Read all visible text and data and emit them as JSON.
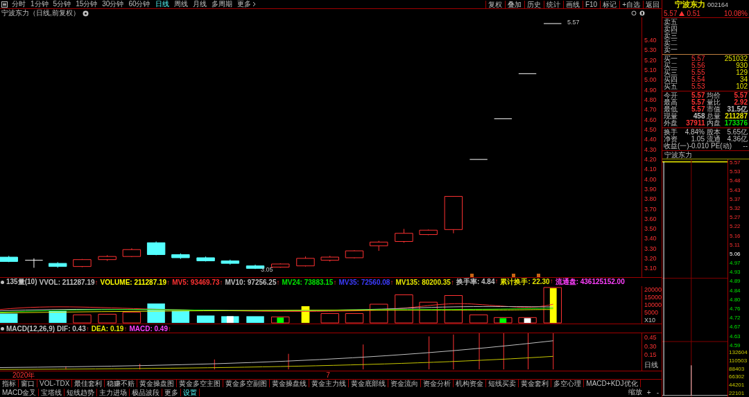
{
  "periods": [
    {
      "label": "分时",
      "selected": false
    },
    {
      "label": "1分钟",
      "selected": false
    },
    {
      "label": "5分钟",
      "selected": false
    },
    {
      "label": "15分钟",
      "selected": false
    },
    {
      "label": "30分钟",
      "selected": false
    },
    {
      "label": "60分钟",
      "selected": false
    },
    {
      "label": "日线",
      "selected": true
    },
    {
      "label": "周线",
      "selected": false
    },
    {
      "label": "月线",
      "selected": false
    },
    {
      "label": "多周期",
      "selected": false
    }
  ],
  "more": "更多",
  "tools": [
    "复权",
    "叠加",
    "历史",
    "统计",
    "画线",
    "F10",
    "标记",
    "+自选",
    "返回"
  ],
  "chart_title": "宁波东力（日线,前复权）",
  "price_axis": [
    "5.40",
    "5.30",
    "5.20",
    "5.10",
    "5.00",
    "4.90",
    "4.80",
    "4.70",
    "4.60",
    "4.50",
    "4.40",
    "4.30",
    "4.20",
    "4.10",
    "4.00",
    "3.90",
    "3.80",
    "3.70",
    "3.60",
    "3.50",
    "3.40",
    "3.30",
    "3.20",
    "3.10"
  ],
  "high_label": "5.57",
  "low_label": "3.05",
  "volume_line": [
    {
      "text": "135量(10)",
      "color": "#c0c0c0"
    },
    {
      "text": "VVOL: 211287.19",
      "color": "#c0c0c0",
      "arrow": "↑"
    },
    {
      "text": "VOLUME: 211287.19",
      "color": "#ffff00",
      "arrow": "↑"
    },
    {
      "text": "MV5: 93469.73",
      "color": "#ff3232",
      "arrow": "↑"
    },
    {
      "text": "MV10: 97256.25",
      "color": "#c0c0c0",
      "arrow": "↑"
    },
    {
      "text": "MV24: 73883.15",
      "color": "#00e600",
      "arrow": "↑"
    },
    {
      "text": "MV35: 72560.08",
      "color": "#3c3cff",
      "arrow": "↑"
    },
    {
      "text": "MV135: 80200.35",
      "color": "#e6e600",
      "arrow": "↑"
    },
    {
      "text": "换手率: 4.84",
      "color": "#c0c0c0",
      "arrow": "↑"
    },
    {
      "text": "累计换手: 22.30",
      "color": "#e6e600",
      "arrow": "↑"
    },
    {
      "text": "流通盘: 436125152.00",
      "color": "#ff40ff"
    }
  ],
  "volume_axis": [
    "20000",
    "15000",
    "10000",
    "5000"
  ],
  "volume_unit": "X10",
  "macd_line": [
    {
      "text": "MACD(12,26,9)",
      "color": "#c0c0c0"
    },
    {
      "text": "DIF: 0.43",
      "color": "#c0c0c0",
      "arrow": "↑"
    },
    {
      "text": "DEA: 0.19",
      "color": "#e6e600",
      "arrow": "↑"
    },
    {
      "text": "MACD: 0.49",
      "color": "#ff40ff",
      "arrow": "↑"
    }
  ],
  "macd_axis": [
    "0.45",
    "0.30",
    "0.15"
  ],
  "macd_period": "日线",
  "year_label": "2020年",
  "month_label": "7",
  "bottom_tabs": [
    {
      "label": "指标",
      "selected": false
    },
    {
      "label": "窗口",
      "selected": false
    },
    {
      "label": "VOL-TDX",
      "selected": false
    },
    {
      "label": "最佳套利",
      "selected": false
    },
    {
      "label": "稳赚不赔",
      "selected": false
    },
    {
      "label": "黄金操盘图",
      "selected": false
    },
    {
      "label": "黄金多空主图",
      "selected": false
    },
    {
      "label": "黄金多空副图",
      "selected": false
    },
    {
      "label": "黄金操盘线",
      "selected": false
    },
    {
      "label": "黄金主力线",
      "selected": false
    },
    {
      "label": "黄金底部线",
      "selected": false
    },
    {
      "label": "资金流向",
      "selected": false
    },
    {
      "label": "资金分析",
      "selected": false
    },
    {
      "label": "机构资金",
      "selected": false
    },
    {
      "label": "短线买卖",
      "selected": false
    },
    {
      "label": "黄金套利",
      "selected": false
    },
    {
      "label": "多空心理",
      "selected": false
    },
    {
      "label": "MACD+KDJ优化",
      "selected": false
    },
    {
      "label": "MACD金叉",
      "selected": false
    },
    {
      "label": "宝塔线",
      "selected": false
    },
    {
      "label": "短线趋势",
      "selected": false
    },
    {
      "label": "主力进场",
      "selected": false
    },
    {
      "label": "极品波段",
      "selected": false
    },
    {
      "label": "更多",
      "selected": false
    },
    {
      "label": "设置",
      "selected": true
    }
  ],
  "zoom_label": "缩放",
  "zoom_in": "+",
  "zoom_out": "-",
  "quote": {
    "name": "宁波东力",
    "code": "002164",
    "price": "5.57",
    "change": "0.51",
    "percent": "10.08%"
  },
  "asks": [
    "卖五",
    "卖四",
    "卖三",
    "卖二",
    "卖一"
  ],
  "bids": [
    {
      "label": "买一",
      "price": "5.57",
      "volume": "251032"
    },
    {
      "label": "买二",
      "price": "5.56",
      "volume": "930"
    },
    {
      "label": "买三",
      "price": "5.55",
      "volume": "129"
    },
    {
      "label": "买四",
      "price": "5.54",
      "volume": "34"
    },
    {
      "label": "买五",
      "price": "5.53",
      "volume": "102"
    }
  ],
  "stats": [
    {
      "label": "今开",
      "value": "5.57",
      "color": "#ff3232"
    },
    {
      "label": "均价",
      "value": "5.57",
      "color": "#ff3232"
    },
    {
      "label": "最高",
      "value": "5.57",
      "color": "#ff3232"
    },
    {
      "label": "量比",
      "value": "2.92",
      "color": "#ff3232"
    },
    {
      "label": "最低",
      "value": "5.57",
      "color": "#ff3232"
    },
    {
      "label": "市值",
      "value": "31.5亿",
      "color": "#c0c0c0"
    },
    {
      "label": "现量",
      "value": "458",
      "color": "#c0c0c0"
    },
    {
      "label": "总量",
      "value": "211287",
      "color": "#e6e600"
    },
    {
      "label": "外盘",
      "value": "37911",
      "color": "#ff3232"
    },
    {
      "label": "内盘",
      "value": "173376",
      "color": "#00e600"
    }
  ],
  "fundamentals": [
    {
      "label": "换手",
      "value": "4.84%",
      "label2": "股本",
      "value2": "5.65亿"
    },
    {
      "label": "净资",
      "value": "1.05",
      "label2": "流通",
      "value2": "4.36亿"
    },
    {
      "label": "收益(一)",
      "value": "-0.010",
      "label2": "PE(动)",
      "value2": "--"
    }
  ],
  "mini_title": "宁波东力",
  "mini_price_axis": [
    "5.57",
    "5.53",
    "5.48",
    "5.43",
    "5.37",
    "5.32",
    "5.27",
    "5.22",
    "5.16",
    "5.11",
    "5.06",
    "4.97",
    "4.93",
    "4.89",
    "4.84",
    "4.80",
    "4.76",
    "4.72",
    "4.67",
    "4.63",
    "4.59"
  ],
  "mini_volume_axis": [
    "132604",
    "110503",
    "88403",
    "66302",
    "44201",
    "22101"
  ]
}
